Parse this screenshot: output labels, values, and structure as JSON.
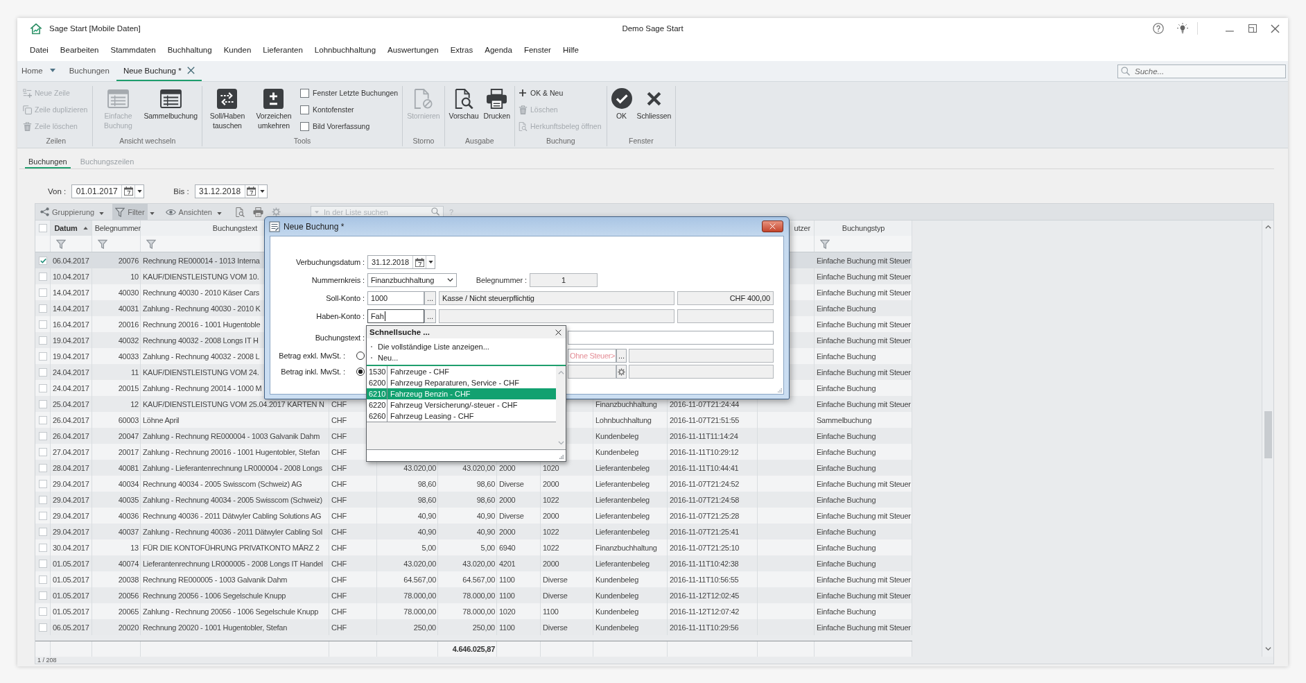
{
  "window": {
    "title": "Sage Start [Mobile Daten]",
    "company": "Demo Sage Start"
  },
  "menu": [
    "Datei",
    "Bearbeiten",
    "Stammdaten",
    "Buchhaltung",
    "Kunden",
    "Lieferanten",
    "Lohnbuchhaltung",
    "Auswertungen",
    "Extras",
    "Agenda",
    "Fenster",
    "Hilfe"
  ],
  "tabs": [
    {
      "label": "Home",
      "selected": false,
      "dropdown": true,
      "closable": false
    },
    {
      "label": "Buchungen",
      "selected": false,
      "dropdown": false,
      "closable": false
    },
    {
      "label": "Neue Buchung *",
      "selected": true,
      "dropdown": false,
      "closable": true
    }
  ],
  "search": {
    "placeholder": "Suche..."
  },
  "ribbon": [
    {
      "label": "Zeilen",
      "items": [
        {
          "kind": "small",
          "label": "Neue Zeile",
          "disabled": true
        },
        {
          "kind": "small",
          "label": "Zeile duplizieren",
          "disabled": true
        },
        {
          "kind": "small",
          "label": "Zeile löschen",
          "disabled": true
        }
      ]
    },
    {
      "label": "Ansicht wechseln",
      "items": [
        {
          "kind": "large",
          "label": "Einfache Buchung",
          "disabled": true
        },
        {
          "kind": "large",
          "label": "Sammelbuchung",
          "disabled": false
        }
      ]
    },
    {
      "label": "Tools",
      "items": [
        {
          "kind": "large",
          "label": "Soll/Haben tauschen",
          "disabled": false
        },
        {
          "kind": "large",
          "label": "Vorzeichen umkehren",
          "disabled": false
        }
      ],
      "options": [
        {
          "label": "Fenster Letzte Buchungen",
          "checked": false
        },
        {
          "label": "Kontofenster",
          "checked": false
        },
        {
          "label": "Bild Vorerfassung",
          "checked": false
        }
      ]
    },
    {
      "label": "Storno",
      "items": [
        {
          "kind": "large",
          "label": "Stornieren",
          "disabled": true
        }
      ]
    },
    {
      "label": "Ausgabe",
      "items": [
        {
          "kind": "large",
          "label": "Vorschau",
          "disabled": false
        },
        {
          "kind": "large",
          "label": "Drucken",
          "disabled": false
        }
      ]
    },
    {
      "label": "Buchung",
      "items": [
        {
          "kind": "small",
          "label": "OK & Neu",
          "disabled": false
        },
        {
          "kind": "small",
          "label": "Löschen",
          "disabled": true
        },
        {
          "kind": "small",
          "label": "Herkunftsbeleg öffnen",
          "disabled": true
        }
      ]
    },
    {
      "label": "Fenster",
      "items": [
        {
          "kind": "large",
          "label": "OK",
          "disabled": false
        },
        {
          "kind": "large",
          "label": "Schliessen",
          "disabled": false
        }
      ]
    }
  ],
  "view_tabs": [
    {
      "label": "Buchungen",
      "selected": true
    },
    {
      "label": "Buchungszeilen",
      "selected": false
    }
  ],
  "date_filter": [
    {
      "label": "Von :",
      "value": "01.01.2017"
    },
    {
      "label": "Bis :",
      "value": "31.12.2018"
    }
  ],
  "grid_toolbar": {
    "items": [
      {
        "label": "Gruppierung",
        "active": false
      },
      {
        "label": "Filter",
        "active": true
      },
      {
        "label": "Ansichten",
        "active": false
      }
    ],
    "search": {
      "placeholder": "In der Liste suchen"
    },
    "help": "?"
  },
  "grid": {
    "select_all": {
      "checked": false
    },
    "columns": [
      {
        "label": "Datum",
        "sorted": true,
        "filterable": true
      },
      {
        "label": "Belegnummer",
        "sorted": false,
        "filterable": true
      },
      {
        "label": "Buchungstext",
        "sorted": false,
        "filterable": true
      },
      null,
      null,
      null,
      null,
      null,
      null,
      null,
      {
        "label": "utzer",
        "sorted": false,
        "filterable": false
      },
      {
        "label": "Buchungstyp",
        "sorted": false,
        "filterable": true
      }
    ],
    "rows": [
      {
        "checked": true,
        "selected": true,
        "cells": [
          "06.04.2017",
          "20076",
          "Rechnung RE000014 - 1013 Interna",
          null,
          null,
          null,
          null,
          null,
          null,
          null,
          null,
          "Einfache Buchung mit Steuer"
        ]
      },
      {
        "checked": false,
        "selected": false,
        "cells": [
          "10.04.2017",
          "10",
          "KAUF/DIENSTLEISTUNG VOM 10.",
          null,
          null,
          null,
          null,
          null,
          null,
          null,
          null,
          "Einfache Buchung mit Steuer"
        ]
      },
      {
        "checked": false,
        "selected": false,
        "cells": [
          "14.04.2017",
          "40030",
          "Rechnung 40030 - 2010 Käser Cars",
          null,
          null,
          null,
          null,
          null,
          null,
          null,
          null,
          "Einfache Buchung mit Steuer"
        ]
      },
      {
        "checked": false,
        "selected": false,
        "cells": [
          "14.04.2017",
          "40031",
          "Zahlung - Rechnung 40030 - 2010 K",
          null,
          null,
          null,
          null,
          null,
          null,
          null,
          null,
          "Einfache Buchung"
        ]
      },
      {
        "checked": false,
        "selected": false,
        "cells": [
          "16.04.2017",
          "20016",
          "Rechnung 20016 - 1001 Hugentoble",
          null,
          null,
          null,
          null,
          null,
          null,
          null,
          null,
          "Einfache Buchung mit Steuer"
        ]
      },
      {
        "checked": false,
        "selected": false,
        "cells": [
          "19.04.2017",
          "40032",
          "Rechnung 40032 - 2008 Longs IT H",
          null,
          null,
          null,
          null,
          null,
          null,
          null,
          null,
          "Einfache Buchung mit Steuer"
        ]
      },
      {
        "checked": false,
        "selected": false,
        "cells": [
          "19.04.2017",
          "40033",
          "Zahlung - Rechnung 40032 - 2008 L",
          null,
          null,
          null,
          null,
          null,
          null,
          null,
          null,
          "Einfache Buchung"
        ]
      },
      {
        "checked": false,
        "selected": false,
        "cells": [
          "24.04.2017",
          "11",
          "KAUF/DIENSTLEISTUNG VOM 24.",
          null,
          null,
          null,
          null,
          null,
          null,
          null,
          null,
          "Einfache Buchung mit Steuer"
        ]
      },
      {
        "checked": false,
        "selected": false,
        "cells": [
          "24.04.2017",
          "20015",
          "Zahlung - Rechnung 20014 - 1000 M",
          null,
          null,
          null,
          null,
          null,
          null,
          null,
          null,
          "Einfache Buchung"
        ]
      },
      {
        "checked": false,
        "selected": false,
        "cells": [
          "25.04.2017",
          "12",
          "KAUF/DIENSTLEISTUNG VOM 25.04.2017 KARTEN N",
          "CHF",
          null,
          null,
          null,
          null,
          "Finanzbuchhaltung",
          "2016-11-07T21:24:44",
          null,
          "Einfache Buchung mit Steuer"
        ]
      },
      {
        "checked": false,
        "selected": false,
        "cells": [
          "26.04.2017",
          "60003",
          "Löhne April",
          "CHF",
          null,
          null,
          null,
          null,
          "Lohnbuchhaltung",
          "2016-11-07T21:51:55",
          null,
          "Sammelbuchung"
        ]
      },
      {
        "checked": false,
        "selected": false,
        "cells": [
          "26.04.2017",
          "20047",
          "Zahlung - Rechnung RE000004 - 1003 Galvanik Dahm",
          "CHF",
          null,
          null,
          null,
          null,
          "Kundenbeleg",
          "2016-11-11T11:14:24",
          null,
          "Einfache Buchung"
        ]
      },
      {
        "checked": false,
        "selected": false,
        "cells": [
          "27.04.2017",
          "20017",
          "Zahlung - Rechnung 20016 - 1001 Hugentobler, Stefan",
          "CHF",
          null,
          null,
          null,
          null,
          "Kundenbeleg",
          "2016-11-11T10:29:12",
          null,
          "Einfache Buchung"
        ]
      },
      {
        "checked": false,
        "selected": false,
        "cells": [
          "28.04.2017",
          "40081",
          "Zahlung - Lieferantenrechnung LR000004 - 2008 Longs",
          "CHF",
          "43.020,00",
          "43.020,00",
          "2000",
          "1020",
          "Lieferantenbeleg",
          "2016-11-11T10:44:41",
          null,
          "Einfache Buchung"
        ]
      },
      {
        "checked": false,
        "selected": false,
        "cells": [
          "29.04.2017",
          "40034",
          "Rechnung 40034 - 2005 Swisscom (Schweiz) AG",
          "CHF",
          "98,60",
          "98,60",
          "Diverse",
          "2000",
          "Lieferantenbeleg",
          "2016-11-07T21:24:52",
          null,
          "Einfache Buchung mit Steuer"
        ]
      },
      {
        "checked": false,
        "selected": false,
        "cells": [
          "29.04.2017",
          "40035",
          "Zahlung - Rechnung 40034 - 2005 Swisscom (Schweiz)",
          "CHF",
          "98,60",
          "98,60",
          "2000",
          "1022",
          "Lieferantenbeleg",
          "2016-11-07T21:24:58",
          null,
          "Einfache Buchung"
        ]
      },
      {
        "checked": false,
        "selected": false,
        "cells": [
          "29.04.2017",
          "40036",
          "Rechnung 40036 - 2011 Dätwyler Cabling Solutions AG",
          "CHF",
          "40,90",
          "40,90",
          "Diverse",
          "2000",
          "Lieferantenbeleg",
          "2016-11-07T21:25:28",
          null,
          "Einfache Buchung mit Steuer"
        ]
      },
      {
        "checked": false,
        "selected": false,
        "cells": [
          "29.04.2017",
          "40037",
          "Zahlung - Rechnung 40036 - 2011 Dätwyler Cabling Sol",
          "CHF",
          "40,90",
          "40,90",
          "2000",
          "1022",
          "Lieferantenbeleg",
          "2016-11-07T21:25:41",
          null,
          "Einfache Buchung"
        ]
      },
      {
        "checked": false,
        "selected": false,
        "cells": [
          "30.04.2017",
          "13",
          "FÜR DIE KONTOFÜHRUNG PRIVATKONTO MÄRZ 2",
          "CHF",
          "5,00",
          "5,00",
          "6940",
          "1022",
          "Finanzbuchhaltung",
          "2016-11-07T21:25:10",
          null,
          "Einfache Buchung"
        ]
      },
      {
        "checked": false,
        "selected": false,
        "cells": [
          "01.05.2017",
          "40074",
          "Lieferantenrechnung LR000005 - 2008 Longs IT Handel",
          "CHF",
          "43.020,00",
          "43.020,00",
          "4201",
          "2000",
          "Lieferantenbeleg",
          "2016-11-11T10:42:38",
          null,
          "Einfache Buchung"
        ]
      },
      {
        "checked": false,
        "selected": false,
        "cells": [
          "01.05.2017",
          "20038",
          "Rechnung RE000005 - 1003 Galvanik Dahm",
          "CHF",
          "64.567,00",
          "64.567,00",
          "1100",
          "Diverse",
          "Kundenbeleg",
          "2016-11-11T10:56:55",
          null,
          "Einfache Buchung mit Steuer"
        ]
      },
      {
        "checked": false,
        "selected": false,
        "cells": [
          "01.05.2017",
          "20056",
          "Rechnung 20056 - 1006 Segelschule Knupp",
          "CHF",
          "78.000,00",
          "78.000,00",
          "1100",
          "Diverse",
          "Kundenbeleg",
          "2016-11-12T12:02:45",
          null,
          "Einfache Buchung mit Steuer"
        ]
      },
      {
        "checked": false,
        "selected": false,
        "cells": [
          "01.05.2017",
          "20065",
          "Zahlung - Rechnung 20056 - 1006 Segelschule Knupp",
          "CHF",
          "78.000,00",
          "78.000,00",
          "1020",
          "1100",
          "Kundenbeleg",
          "2016-11-12T12:07:42",
          null,
          "Einfache Buchung"
        ]
      },
      {
        "checked": false,
        "selected": false,
        "cells": [
          "06.05.2017",
          "20020",
          "Rechnung 20020 - 1001 Hugentobler, Stefan",
          "CHF",
          "250,00",
          "250,00",
          "1100",
          "Diverse",
          "Kundenbeleg",
          "2016-11-11T10:29:56",
          null,
          "Einfache Buchung mit Steuer"
        ]
      }
    ],
    "total": "4.646.025,87",
    "status": "1 / 208"
  },
  "dialog": {
    "title": "Neue Buchung *",
    "booking_date": {
      "label": "Verbuchungsdatum :",
      "value": "31.12.2018"
    },
    "number_range": {
      "label": "Nummernkreis :",
      "value": "Finanzbuchhaltung"
    },
    "document_number": {
      "label": "Belegnummer :",
      "value": "1"
    },
    "debit_account": {
      "label": "Soll-Konto :",
      "value": "1000",
      "button": "...",
      "name": "Kasse / Nicht steuerpflichtig",
      "balance": "CHF 400,00",
      "focused": false
    },
    "credit_account": {
      "label": "Haben-Konto :",
      "value": "Fah",
      "button": "...",
      "focused": true
    },
    "booking_text": {
      "label": "Buchungstext :"
    },
    "amount_options": [
      {
        "kind": "tax_code",
        "label": "Betrag exkl. MwSt. :",
        "selected": false,
        "tax_code_placeholder": "Ohne Steuer>",
        "button": "..."
      },
      {
        "kind": "tax_settings",
        "label": "Betrag inkl. MwSt. :",
        "selected": true
      }
    ]
  },
  "quick_search": {
    "title": "Schnellsuche ...",
    "actions": [
      "Die vollständige Liste anzeigen...",
      "Neu..."
    ],
    "results": [
      {
        "code": "1530",
        "name": "Fahrzeuge - CHF",
        "selected": false
      },
      {
        "code": "6200",
        "name": "Fahrzeug Reparaturen, Service - CHF",
        "selected": false
      },
      {
        "code": "6210",
        "name": "Fahrzeug Benzin - CHF",
        "selected": true
      },
      {
        "code": "6220",
        "name": "Fahrzeug Versicherung/-steuer - CHF",
        "selected": false
      },
      {
        "code": "6260",
        "name": "Fahrzeug Leasing - CHF",
        "selected": false
      }
    ]
  }
}
